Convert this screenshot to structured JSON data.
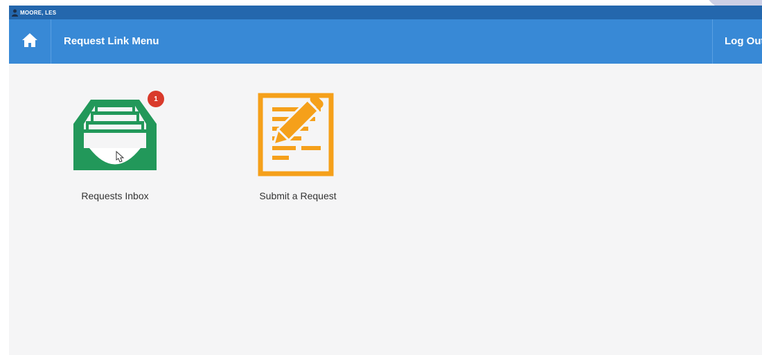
{
  "user": {
    "name": "MOORE, LES",
    "icon": "person-icon"
  },
  "navbar": {
    "home_icon": "home-icon",
    "title": "Request Link Menu",
    "logout_label": "Log Out"
  },
  "tiles": [
    {
      "label": "Requests Inbox",
      "icon": "inbox-tray-icon",
      "badge": "1",
      "color": "#22985a"
    },
    {
      "label": "Submit a Request",
      "icon": "document-pencil-icon",
      "color": "#f5a01a"
    }
  ],
  "colors": {
    "userbar": "#2467ad",
    "navbar": "#3889d6",
    "badge": "#d93a2b",
    "background": "#f5f5f6"
  }
}
